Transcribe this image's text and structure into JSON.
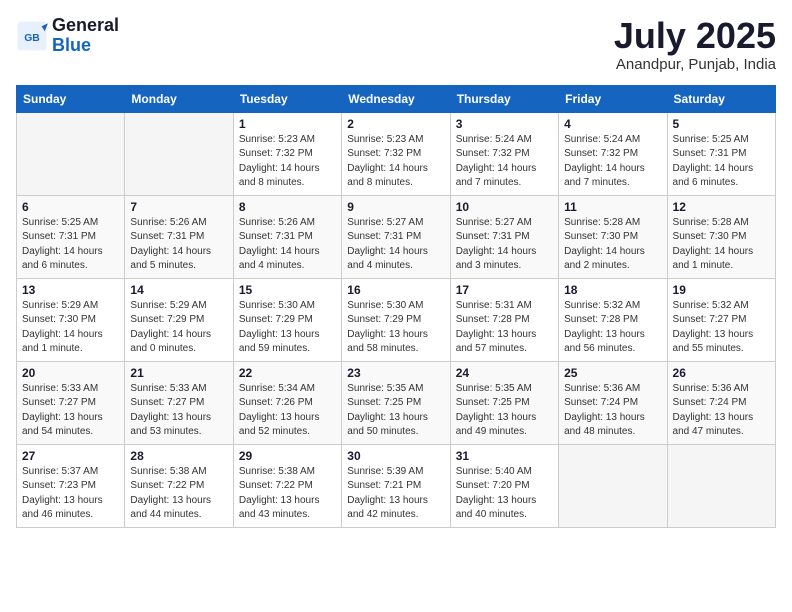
{
  "header": {
    "logo_general": "General",
    "logo_blue": "Blue",
    "month": "July 2025",
    "location": "Anandpur, Punjab, India"
  },
  "weekdays": [
    "Sunday",
    "Monday",
    "Tuesday",
    "Wednesday",
    "Thursday",
    "Friday",
    "Saturday"
  ],
  "weeks": [
    [
      {
        "day": "",
        "sunrise": "",
        "sunset": "",
        "daylight": "",
        "empty": true
      },
      {
        "day": "",
        "sunrise": "",
        "sunset": "",
        "daylight": "",
        "empty": true
      },
      {
        "day": "1",
        "sunrise": "Sunrise: 5:23 AM",
        "sunset": "Sunset: 7:32 PM",
        "daylight": "Daylight: 14 hours and 8 minutes."
      },
      {
        "day": "2",
        "sunrise": "Sunrise: 5:23 AM",
        "sunset": "Sunset: 7:32 PM",
        "daylight": "Daylight: 14 hours and 8 minutes."
      },
      {
        "day": "3",
        "sunrise": "Sunrise: 5:24 AM",
        "sunset": "Sunset: 7:32 PM",
        "daylight": "Daylight: 14 hours and 7 minutes."
      },
      {
        "day": "4",
        "sunrise": "Sunrise: 5:24 AM",
        "sunset": "Sunset: 7:32 PM",
        "daylight": "Daylight: 14 hours and 7 minutes."
      },
      {
        "day": "5",
        "sunrise": "Sunrise: 5:25 AM",
        "sunset": "Sunset: 7:31 PM",
        "daylight": "Daylight: 14 hours and 6 minutes."
      }
    ],
    [
      {
        "day": "6",
        "sunrise": "Sunrise: 5:25 AM",
        "sunset": "Sunset: 7:31 PM",
        "daylight": "Daylight: 14 hours and 6 minutes."
      },
      {
        "day": "7",
        "sunrise": "Sunrise: 5:26 AM",
        "sunset": "Sunset: 7:31 PM",
        "daylight": "Daylight: 14 hours and 5 minutes."
      },
      {
        "day": "8",
        "sunrise": "Sunrise: 5:26 AM",
        "sunset": "Sunset: 7:31 PM",
        "daylight": "Daylight: 14 hours and 4 minutes."
      },
      {
        "day": "9",
        "sunrise": "Sunrise: 5:27 AM",
        "sunset": "Sunset: 7:31 PM",
        "daylight": "Daylight: 14 hours and 4 minutes."
      },
      {
        "day": "10",
        "sunrise": "Sunrise: 5:27 AM",
        "sunset": "Sunset: 7:31 PM",
        "daylight": "Daylight: 14 hours and 3 minutes."
      },
      {
        "day": "11",
        "sunrise": "Sunrise: 5:28 AM",
        "sunset": "Sunset: 7:30 PM",
        "daylight": "Daylight: 14 hours and 2 minutes."
      },
      {
        "day": "12",
        "sunrise": "Sunrise: 5:28 AM",
        "sunset": "Sunset: 7:30 PM",
        "daylight": "Daylight: 14 hours and 1 minute."
      }
    ],
    [
      {
        "day": "13",
        "sunrise": "Sunrise: 5:29 AM",
        "sunset": "Sunset: 7:30 PM",
        "daylight": "Daylight: 14 hours and 1 minute."
      },
      {
        "day": "14",
        "sunrise": "Sunrise: 5:29 AM",
        "sunset": "Sunset: 7:29 PM",
        "daylight": "Daylight: 14 hours and 0 minutes."
      },
      {
        "day": "15",
        "sunrise": "Sunrise: 5:30 AM",
        "sunset": "Sunset: 7:29 PM",
        "daylight": "Daylight: 13 hours and 59 minutes."
      },
      {
        "day": "16",
        "sunrise": "Sunrise: 5:30 AM",
        "sunset": "Sunset: 7:29 PM",
        "daylight": "Daylight: 13 hours and 58 minutes."
      },
      {
        "day": "17",
        "sunrise": "Sunrise: 5:31 AM",
        "sunset": "Sunset: 7:28 PM",
        "daylight": "Daylight: 13 hours and 57 minutes."
      },
      {
        "day": "18",
        "sunrise": "Sunrise: 5:32 AM",
        "sunset": "Sunset: 7:28 PM",
        "daylight": "Daylight: 13 hours and 56 minutes."
      },
      {
        "day": "19",
        "sunrise": "Sunrise: 5:32 AM",
        "sunset": "Sunset: 7:27 PM",
        "daylight": "Daylight: 13 hours and 55 minutes."
      }
    ],
    [
      {
        "day": "20",
        "sunrise": "Sunrise: 5:33 AM",
        "sunset": "Sunset: 7:27 PM",
        "daylight": "Daylight: 13 hours and 54 minutes."
      },
      {
        "day": "21",
        "sunrise": "Sunrise: 5:33 AM",
        "sunset": "Sunset: 7:27 PM",
        "daylight": "Daylight: 13 hours and 53 minutes."
      },
      {
        "day": "22",
        "sunrise": "Sunrise: 5:34 AM",
        "sunset": "Sunset: 7:26 PM",
        "daylight": "Daylight: 13 hours and 52 minutes."
      },
      {
        "day": "23",
        "sunrise": "Sunrise: 5:35 AM",
        "sunset": "Sunset: 7:25 PM",
        "daylight": "Daylight: 13 hours and 50 minutes."
      },
      {
        "day": "24",
        "sunrise": "Sunrise: 5:35 AM",
        "sunset": "Sunset: 7:25 PM",
        "daylight": "Daylight: 13 hours and 49 minutes."
      },
      {
        "day": "25",
        "sunrise": "Sunrise: 5:36 AM",
        "sunset": "Sunset: 7:24 PM",
        "daylight": "Daylight: 13 hours and 48 minutes."
      },
      {
        "day": "26",
        "sunrise": "Sunrise: 5:36 AM",
        "sunset": "Sunset: 7:24 PM",
        "daylight": "Daylight: 13 hours and 47 minutes."
      }
    ],
    [
      {
        "day": "27",
        "sunrise": "Sunrise: 5:37 AM",
        "sunset": "Sunset: 7:23 PM",
        "daylight": "Daylight: 13 hours and 46 minutes."
      },
      {
        "day": "28",
        "sunrise": "Sunrise: 5:38 AM",
        "sunset": "Sunset: 7:22 PM",
        "daylight": "Daylight: 13 hours and 44 minutes."
      },
      {
        "day": "29",
        "sunrise": "Sunrise: 5:38 AM",
        "sunset": "Sunset: 7:22 PM",
        "daylight": "Daylight: 13 hours and 43 minutes."
      },
      {
        "day": "30",
        "sunrise": "Sunrise: 5:39 AM",
        "sunset": "Sunset: 7:21 PM",
        "daylight": "Daylight: 13 hours and 42 minutes."
      },
      {
        "day": "31",
        "sunrise": "Sunrise: 5:40 AM",
        "sunset": "Sunset: 7:20 PM",
        "daylight": "Daylight: 13 hours and 40 minutes."
      },
      {
        "day": "",
        "sunrise": "",
        "sunset": "",
        "daylight": "",
        "empty": true
      },
      {
        "day": "",
        "sunrise": "",
        "sunset": "",
        "daylight": "",
        "empty": true
      }
    ]
  ]
}
